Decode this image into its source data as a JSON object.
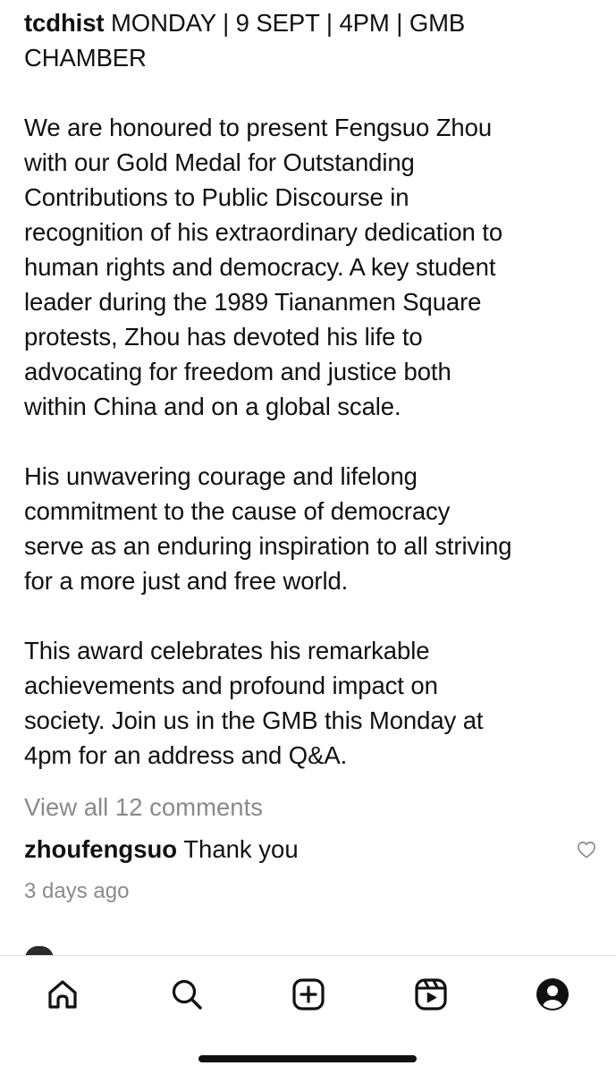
{
  "post": {
    "username": "tcdhist",
    "caption_first": " MONDAY | 9 SEPT | 4PM | GMB",
    "caption_lines": [
      "CHAMBER",
      "",
      "We are honoured to present Fengsuo Zhou",
      "with our Gold Medal for Outstanding",
      "Contributions to Public Discourse in",
      "recognition of his extraordinary dedication to",
      "human rights and democracy. A key student",
      "leader during the 1989 Tiananmen Square",
      "protests, Zhou has devoted his life to",
      "advocating for freedom and justice both",
      "within China and on a global scale.",
      "",
      "His unwavering courage and lifelong",
      "commitment to the cause of democracy",
      "serve as an enduring inspiration to all striving",
      "for a more just and free world.",
      "",
      "This award celebrates his remarkable",
      "achievements and profound impact on",
      "society. Join us in the GMB this Monday at",
      "4pm for an address and Q&A."
    ]
  },
  "comments": {
    "view_all_label": "View all 12 comments",
    "top_comment": {
      "username": "zhoufengsuo",
      "text": " Thank you",
      "like_icon": "heart-outline-icon",
      "time": "3 days ago"
    }
  },
  "tab_bar": {
    "items": [
      {
        "name": "home",
        "icon": "home-icon"
      },
      {
        "name": "search",
        "icon": "search-icon"
      },
      {
        "name": "create",
        "icon": "plus-square-icon"
      },
      {
        "name": "reels",
        "icon": "reels-icon"
      },
      {
        "name": "profile",
        "icon": "profile-icon"
      }
    ]
  },
  "colors": {
    "text": "#111111",
    "secondary_text": "#8a8a8a",
    "background": "#ffffff"
  }
}
